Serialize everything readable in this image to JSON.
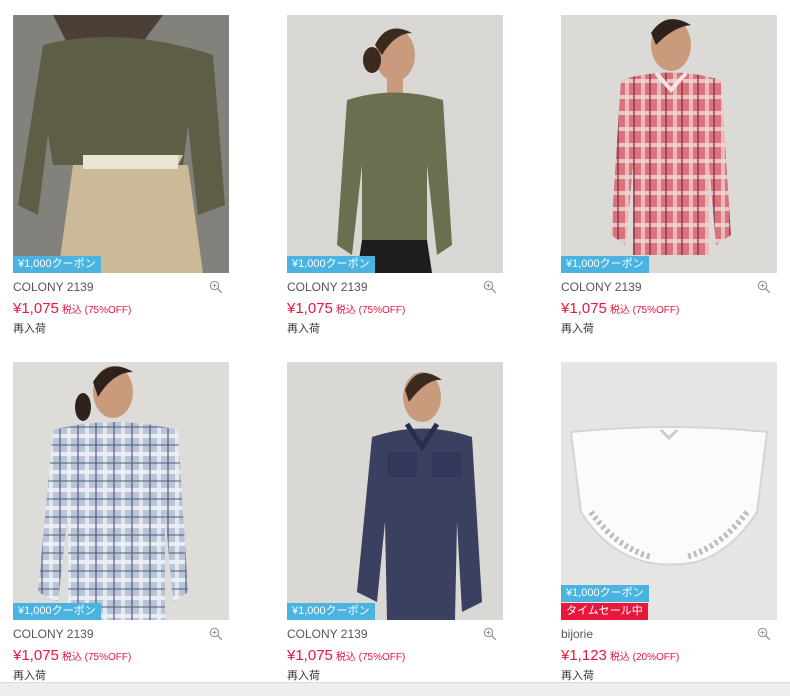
{
  "products": [
    {
      "brand": "COLONY 2139",
      "price": "¥1,075",
      "tax_note": "税込 (75%OFF)",
      "note": "再入荷",
      "badges": [
        "¥1,000クーポン"
      ]
    },
    {
      "brand": "COLONY 2139",
      "price": "¥1,075",
      "tax_note": "税込 (75%OFF)",
      "note": "再入荷",
      "badges": [
        "¥1,000クーポン"
      ]
    },
    {
      "brand": "COLONY 2139",
      "price": "¥1,075",
      "tax_note": "税込 (75%OFF)",
      "note": "再入荷",
      "badges": [
        "¥1,000クーポン"
      ]
    },
    {
      "brand": "COLONY 2139",
      "price": "¥1,075",
      "tax_note": "税込 (75%OFF)",
      "note": "再入荷",
      "badges": [
        "¥1,000クーポン"
      ]
    },
    {
      "brand": "COLONY 2139",
      "price": "¥1,075",
      "tax_note": "税込 (75%OFF)",
      "note": "再入荷",
      "badges": [
        "¥1,000クーポン"
      ]
    },
    {
      "brand": "bijorie",
      "price": "¥1,123",
      "tax_note": "税込 (20%OFF)",
      "note": "再入荷",
      "badges": [
        "¥1,000クーポン",
        "タイムセール中"
      ]
    }
  ],
  "icons": {
    "zoom": "zoom-in-icon"
  },
  "colors": {
    "price": "#e8173c",
    "coupon_badge": "#4ab3e0",
    "sale_badge": "#e8173c",
    "brand_text": "#555555"
  }
}
